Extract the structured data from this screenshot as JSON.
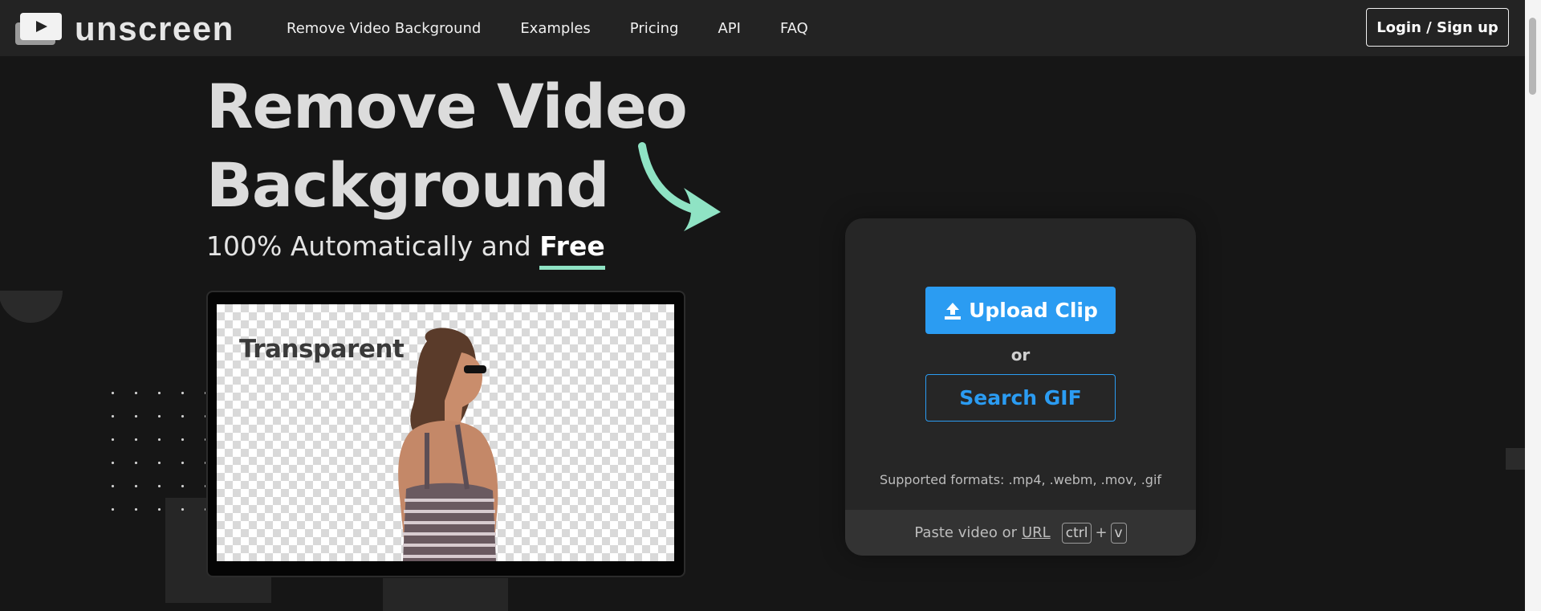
{
  "brand": {
    "name": "unscreen",
    "logo_icon": "play-icon"
  },
  "nav": {
    "items": [
      {
        "label": "Remove Video Background"
      },
      {
        "label": "Examples"
      },
      {
        "label": "Pricing"
      },
      {
        "label": "API"
      },
      {
        "label": "FAQ"
      }
    ],
    "login_label": "Login / Sign up"
  },
  "hero": {
    "title_line1": "Remove Video",
    "title_line2": "Background",
    "subtitle_prefix": "100% Automatically and",
    "subtitle_highlight": "Free",
    "preview_label": "Transparent"
  },
  "upload": {
    "upload_label": "Upload Clip",
    "or_label": "or",
    "search_label": "Search GIF",
    "formats_label": "Supported formats: .mp4, .webm, .mov, .gif",
    "paste_prefix": "Paste video or",
    "paste_url": "URL",
    "key_ctrl": "ctrl",
    "key_plus": "+",
    "key_v": "v"
  },
  "colors": {
    "accent_blue": "#2b9cf2",
    "accent_green": "#8fe3c4",
    "background": "#161616",
    "topbar": "#232323"
  }
}
